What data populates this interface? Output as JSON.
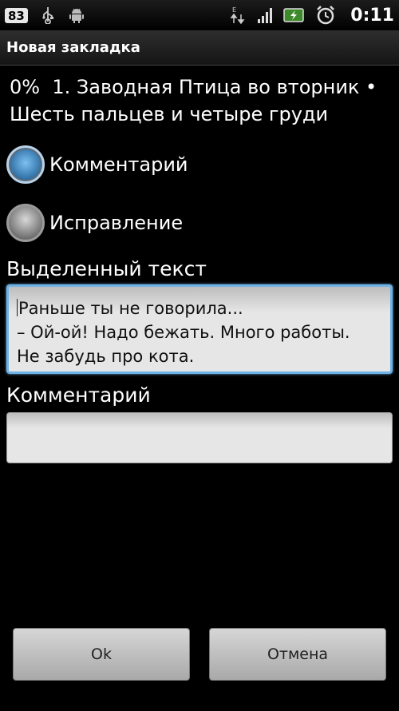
{
  "status_bar": {
    "badge": "83",
    "time": "0:11",
    "icons": [
      "usb-icon",
      "android-icon",
      "data-arrows-icon",
      "signal-icon",
      "battery-icon",
      "alarm-icon"
    ]
  },
  "title_bar": {
    "title": "Новая закладка"
  },
  "header": {
    "line1": "0%  1. Заводная Птица во вторник •",
    "line2": "Шесть пальцев и четыре груди"
  },
  "options": {
    "comment": {
      "label": "Комментарий",
      "checked": true
    },
    "correction": {
      "label": "Исправление",
      "checked": false
    }
  },
  "selected_text": {
    "label": "Выделенный текст",
    "lines": [
      "Раньше ты не говорила...",
      "– Ой-ой! Надо бежать. Много работы.",
      "Не забудь про кота."
    ]
  },
  "comment_field": {
    "label": "Комментарий",
    "value": ""
  },
  "buttons": {
    "ok": "Ok",
    "cancel": "Отмена"
  },
  "colors": {
    "accent": "#6fb2e6",
    "background": "#000000"
  }
}
